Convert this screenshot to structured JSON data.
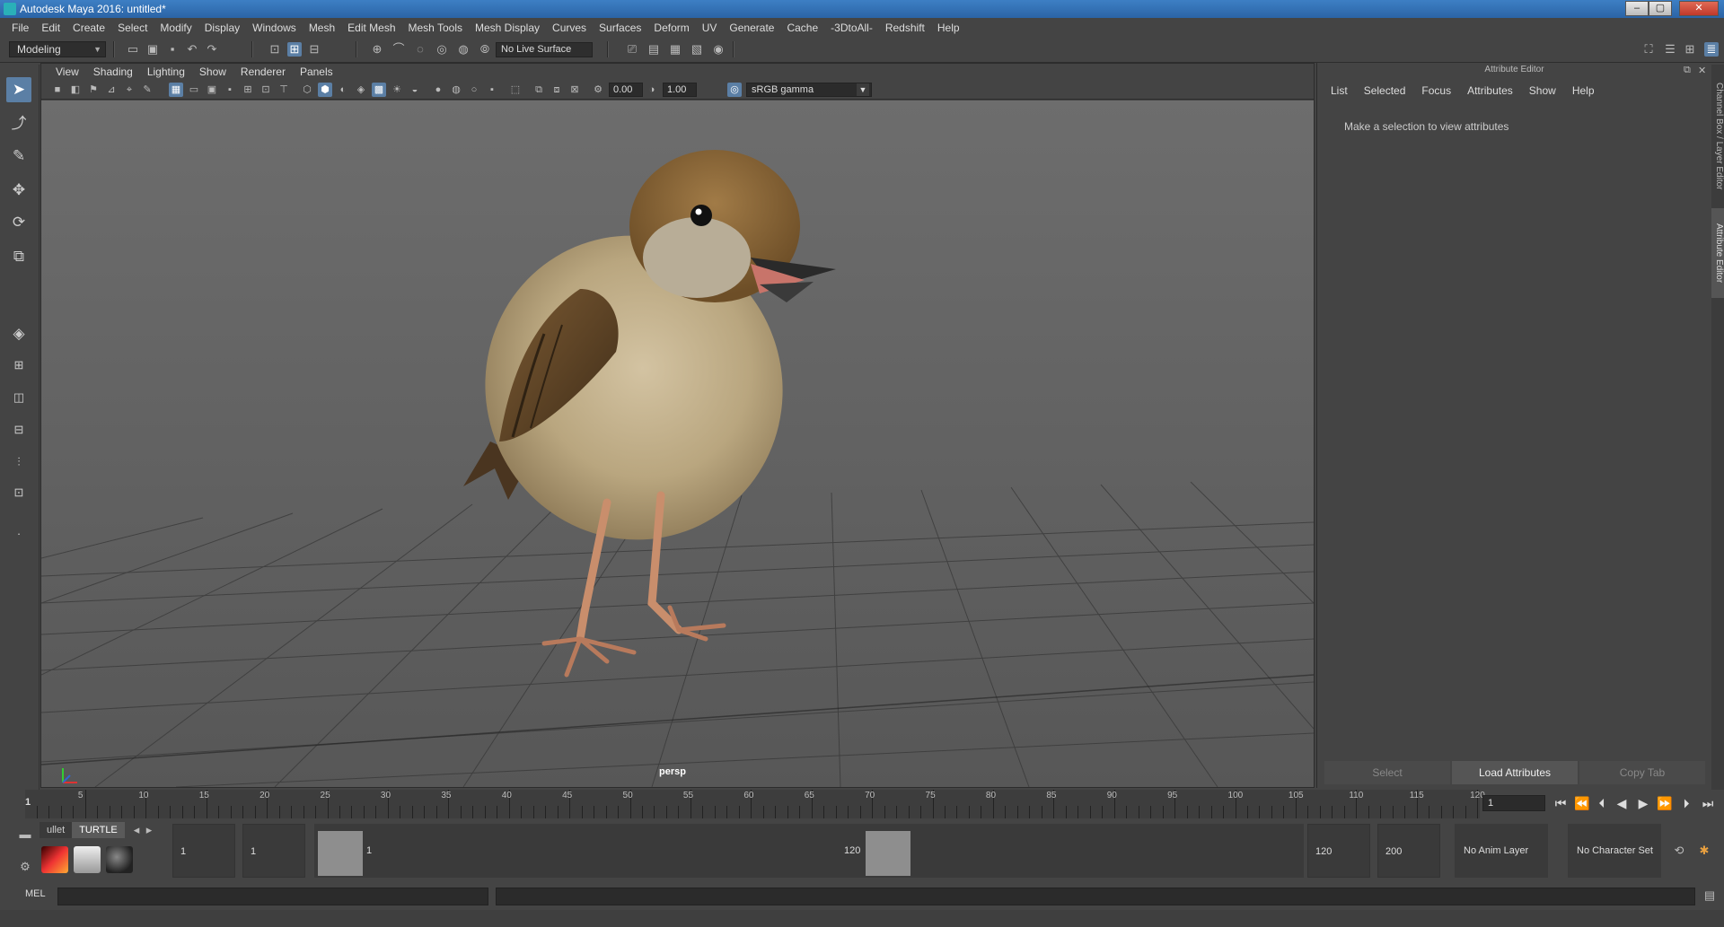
{
  "window": {
    "title": "Autodesk Maya 2016: untitled*",
    "controls": [
      "–",
      "▢",
      "✕"
    ]
  },
  "menubar": [
    "File",
    "Edit",
    "Create",
    "Select",
    "Modify",
    "Display",
    "Windows",
    "Mesh",
    "Edit Mesh",
    "Mesh Tools",
    "Mesh Display",
    "Curves",
    "Surfaces",
    "Deform",
    "UV",
    "Generate",
    "Cache",
    "-3DtoAll-",
    "Redshift",
    "Help"
  ],
  "status_line": {
    "mode": "Modeling",
    "live_surface": "No Live Surface"
  },
  "viewport": {
    "menu": [
      "View",
      "Shading",
      "Lighting",
      "Show",
      "Renderer",
      "Panels"
    ],
    "exposure": "0.00",
    "gamma": "1.00",
    "color_space": "sRGB gamma",
    "camera": "persp"
  },
  "attribute_editor": {
    "title": "Attribute Editor",
    "menu": [
      "List",
      "Selected",
      "Focus",
      "Attributes",
      "Show",
      "Help"
    ],
    "hint": "Make a selection to view attributes",
    "buttons": {
      "select": "Select",
      "load": "Load Attributes",
      "copy": "Copy Tab"
    }
  },
  "side_tabs": {
    "channel": "Channel Box / Layer Editor",
    "attribute": "Attribute Editor"
  },
  "timeline": {
    "ticks": [
      "5",
      "10",
      "15",
      "20",
      "25",
      "30",
      "35",
      "40",
      "45",
      "50",
      "55",
      "60",
      "65",
      "70",
      "75",
      "80",
      "85",
      "90",
      "95",
      "100",
      "105",
      "110",
      "115",
      "120"
    ],
    "current_marker": "1",
    "current_frame": "1"
  },
  "range": {
    "shelf_tabs": [
      "ullet",
      "TURTLE"
    ],
    "start_frame": "1",
    "playback_start": "1",
    "range_start_label": "1",
    "range_end_label": "120",
    "playback_end": "120",
    "end_frame": "200",
    "anim_layer": "No Anim Layer",
    "character_set": "No Character Set"
  },
  "command_line": {
    "label": "MEL"
  },
  "colors": {
    "accent": "#5b7fa5",
    "maya_teal": "#2bc9c9",
    "title_blue": "#2b64a6"
  }
}
